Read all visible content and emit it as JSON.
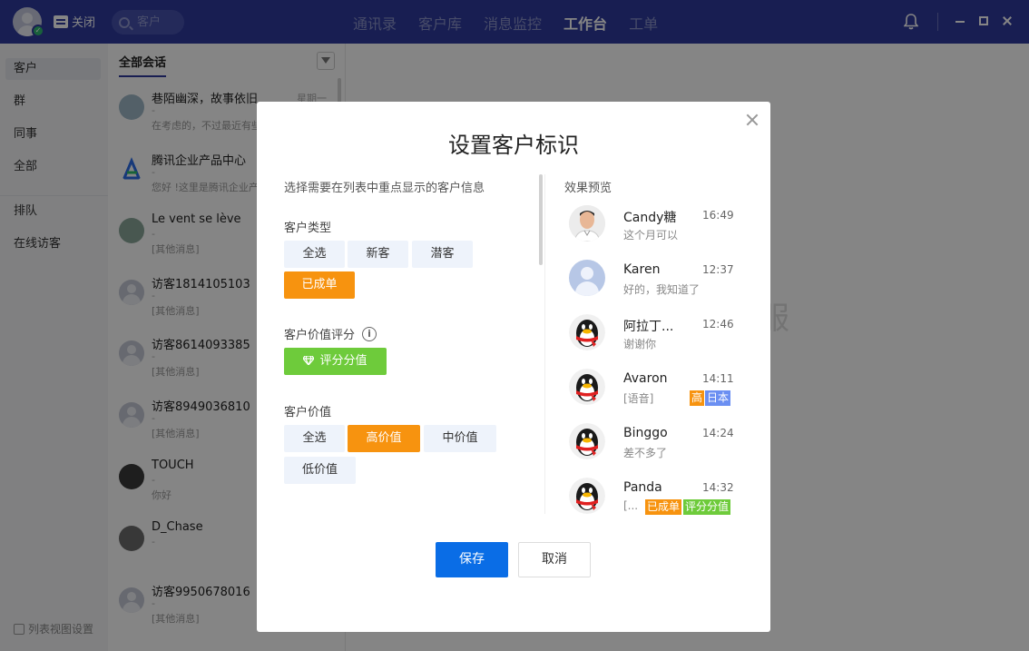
{
  "topbar": {
    "close_label": "关闭",
    "search_placeholder": "客户",
    "nav": [
      "通讯录",
      "客户库",
      "消息监控",
      "工作台",
      "工单"
    ],
    "active_nav": "工作台"
  },
  "sidebar": {
    "items": [
      "客户",
      "群",
      "同事",
      "全部",
      "排队",
      "在线访客"
    ],
    "footer": "列表视图设置"
  },
  "conversations": {
    "header": "全部会话",
    "items": [
      {
        "name": "巷陌幽深，故事依旧",
        "time": "星期一",
        "dash": "-",
        "msg": "在考虑的，不过最近有些"
      },
      {
        "name": "腾讯企业产品中心",
        "time": "",
        "dash": "-",
        "msg": "您好 !这里是腾讯企业产"
      },
      {
        "name": "Le vent se lève",
        "time": "",
        "dash": "-",
        "msg": "[其他消息]"
      },
      {
        "name": "访客1814105103",
        "time": "",
        "dash": "-",
        "msg": "[其他消息]"
      },
      {
        "name": "访客8614093385",
        "time": "",
        "dash": "-",
        "msg": "[其他消息]"
      },
      {
        "name": "访客8949036810",
        "time": "",
        "dash": "-",
        "msg": "[其他消息]"
      },
      {
        "name": "TOUCH",
        "time": "",
        "dash": "-",
        "msg": "你好"
      },
      {
        "name": "D_Chase",
        "time": "",
        "dash": "-",
        "msg": ""
      },
      {
        "name": "访客9950678016",
        "time": "",
        "dash": "-",
        "msg": "[其他消息]"
      }
    ]
  },
  "main": {
    "watermark": "客服"
  },
  "modal": {
    "title": "设置客户标识",
    "instruction": "选择需要在列表中重点显示的客户信息",
    "customer_type": {
      "label": "客户类型",
      "options": [
        "全选",
        "新客",
        "潜客",
        "已成单"
      ],
      "selected": "已成单"
    },
    "value_score": {
      "label": "客户价值评分",
      "button": "评分分值"
    },
    "customer_value": {
      "label": "客户价值",
      "options": [
        "全选",
        "高价值",
        "中价值",
        "低价值"
      ],
      "selected": "高价值"
    },
    "preview": {
      "label": "效果预览",
      "items": [
        {
          "name": "Candy糖",
          "time": "16:49",
          "msg": "这个月可以",
          "tags": []
        },
        {
          "name": "Karen",
          "time": "12:37",
          "msg": "好的，我知道了",
          "tags": []
        },
        {
          "name": "阿拉丁...",
          "time": "12:46",
          "msg": "谢谢你",
          "tags": []
        },
        {
          "name": "Avaron",
          "time": "14:11",
          "msg": "[语音]",
          "tags": [
            "高",
            "日本"
          ]
        },
        {
          "name": "Binggo",
          "time": "14:24",
          "msg": "差不多了",
          "tags": []
        },
        {
          "name": "Panda",
          "time": "14:32",
          "msg": "[...",
          "tags": [
            "已成单",
            "评分分值"
          ]
        }
      ]
    },
    "save_label": "保存",
    "cancel_label": "取消"
  },
  "colors": {
    "topbar": "#2f3b9e",
    "selected_orange": "#f7930f",
    "score_green": "#6ecb3b",
    "tag_blue": "#6b8ff2",
    "primary_button": "#0a6de6"
  }
}
